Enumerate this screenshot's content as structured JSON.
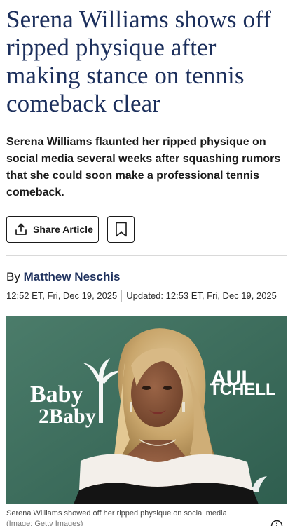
{
  "article": {
    "headline": "Serena Williams shows off ripped physique after making stance on tennis comeback clear",
    "dek": "Serena Williams flaunted her ripped physique on social media several weeks after squashing rumors that she could soon make a professional tennis comeback.",
    "share_label": "Share Article",
    "byline_prefix": "By",
    "author": "Matthew Neschis",
    "published": "12:52 ET, Fri, Dec 19, 2025",
    "updated": "Updated: 12:53 ET, Fri, Dec 19, 2025",
    "photo": {
      "backdrop_text_left_1": "Baby",
      "backdrop_text_left_2": "2Baby",
      "backdrop_text_right_1": "AUL",
      "backdrop_text_right_2": "TCHELL"
    },
    "caption": "Serena Williams showed off her ripped physique on social media",
    "credit": "(Image: Getty Images)"
  },
  "icons": {
    "share": "share-icon",
    "bookmark": "bookmark-icon",
    "info": "info-icon"
  },
  "colors": {
    "headline": "#1c2f5c",
    "author": "#1c2f5c",
    "photo_background": "#3e6f5e"
  }
}
